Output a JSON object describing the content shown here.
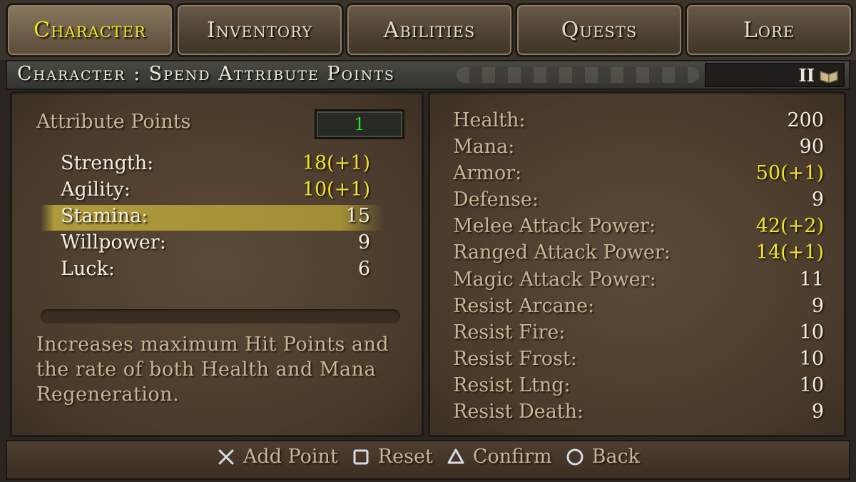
{
  "tabs": [
    {
      "label": "Character",
      "active": true
    },
    {
      "label": "Inventory",
      "active": false
    },
    {
      "label": "Abilities",
      "active": false
    },
    {
      "label": "Quests",
      "active": false
    },
    {
      "label": "Lore",
      "active": false
    }
  ],
  "header": {
    "title": "Character : Spend Attribute Points",
    "page": "II",
    "page_icon": "book-icon"
  },
  "attribute_points": {
    "label": "Attribute Points",
    "value": "1"
  },
  "attributes": [
    {
      "name": "Strength:",
      "value": "18(+1)",
      "boosted": true
    },
    {
      "name": "Agility:",
      "value": "10(+1)",
      "boosted": true
    },
    {
      "name": "Stamina:",
      "value": "15",
      "boosted": false,
      "selected": true
    },
    {
      "name": "Willpower:",
      "value": "9",
      "boosted": false
    },
    {
      "name": "Luck:",
      "value": "6",
      "boosted": false
    }
  ],
  "description": "Increases maximum Hit Points and the rate of both Health and Mana Regeneration.",
  "stats": [
    {
      "name": "Health:",
      "value": "200",
      "boosted": false
    },
    {
      "name": "Mana:",
      "value": "90",
      "boosted": false
    },
    {
      "name": "Armor:",
      "value": "50(+1)",
      "boosted": true
    },
    {
      "name": "Defense:",
      "value": "9",
      "boosted": false
    },
    {
      "name": "Melee Attack Power:",
      "value": "42(+2)",
      "boosted": true
    },
    {
      "name": "Ranged Attack Power:",
      "value": "14(+1)",
      "boosted": true
    },
    {
      "name": "Magic Attack Power:",
      "value": "11",
      "boosted": false
    },
    {
      "name": "Resist Arcane:",
      "value": "9",
      "boosted": false
    },
    {
      "name": "Resist Fire:",
      "value": "10",
      "boosted": false
    },
    {
      "name": "Resist Frost:",
      "value": "10",
      "boosted": false
    },
    {
      "name": "Resist Ltng:",
      "value": "10",
      "boosted": false
    },
    {
      "name": "Resist Death:",
      "value": "9",
      "boosted": false
    }
  ],
  "controls": [
    {
      "icon": "cross-button-icon",
      "label": "Add Point"
    },
    {
      "icon": "square-button-icon",
      "label": "Reset"
    },
    {
      "icon": "triangle-button-icon",
      "label": "Confirm"
    },
    {
      "icon": "circle-button-icon",
      "label": "Back"
    }
  ],
  "colors": {
    "highlight_yellow": "#f0e22a",
    "points_green": "#29e01b",
    "muted_label": "#c5b594",
    "value_white": "#f2ece0"
  }
}
